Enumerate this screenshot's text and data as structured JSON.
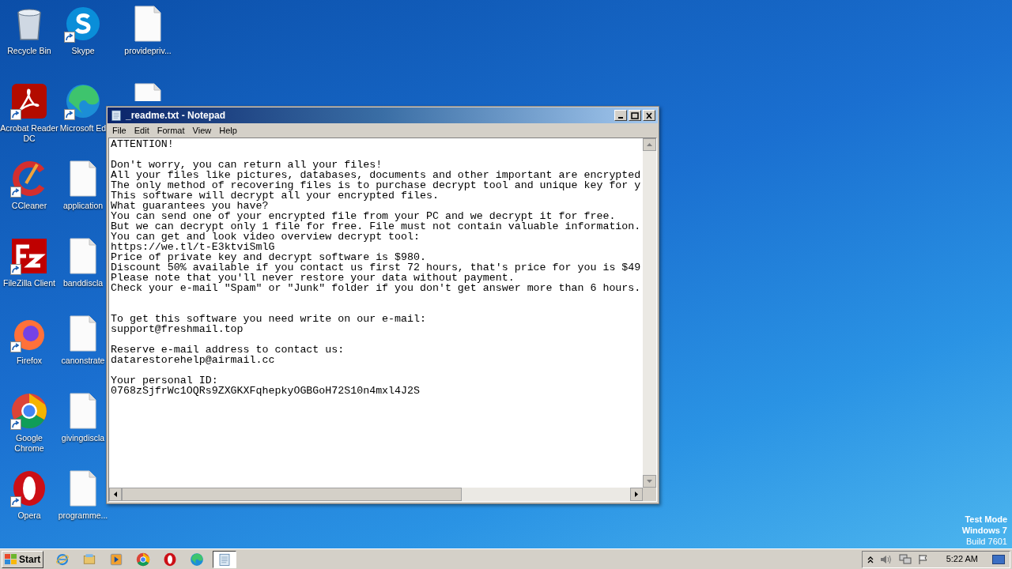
{
  "desktop_columns": [
    {
      "icons": [
        {
          "label": "Recycle Bin",
          "kind": "recycle",
          "shortcut": false
        },
        {
          "label": "Acrobat Reader DC",
          "kind": "acrobat",
          "shortcut": true
        },
        {
          "label": "CCleaner",
          "kind": "ccleaner",
          "shortcut": true
        },
        {
          "label": "FileZilla Client",
          "kind": "filezilla",
          "shortcut": true
        },
        {
          "label": "Firefox",
          "kind": "firefox",
          "shortcut": true
        },
        {
          "label": "Google Chrome",
          "kind": "chrome",
          "shortcut": true
        },
        {
          "label": "Opera",
          "kind": "opera",
          "shortcut": true
        }
      ]
    },
    {
      "icons": [
        {
          "label": "Skype",
          "kind": "skype",
          "shortcut": true
        },
        {
          "label": "Microsoft Ed",
          "kind": "edge",
          "shortcut": true
        },
        {
          "label": "application",
          "kind": "file",
          "shortcut": false
        },
        {
          "label": "banddiscla",
          "kind": "file",
          "shortcut": false
        },
        {
          "label": "canonstrate",
          "kind": "file",
          "shortcut": false
        },
        {
          "label": "givingdiscla",
          "kind": "file",
          "shortcut": false
        },
        {
          "label": "programme...",
          "kind": "file",
          "shortcut": false
        }
      ]
    },
    {
      "icons": [
        {
          "label": "providepriv...",
          "kind": "file",
          "shortcut": false
        },
        {
          "kind": "file",
          "shortcut": false
        }
      ]
    }
  ],
  "notepad": {
    "title": "_readme.txt - Notepad",
    "menu": [
      "File",
      "Edit",
      "Format",
      "View",
      "Help"
    ],
    "paragraphs": [
      {
        "kind": "first",
        "lines": [
          "ATTENTION!"
        ]
      },
      {
        "kind": "after_blank",
        "lines": [
          "Don't worry, you can return all your files!",
          "All your files like pictures, databases, documents and other important are encrypted",
          "The only method of recovering files is to purchase decrypt tool and unique key for y",
          "This software will decrypt all your encrypted files.",
          "What guarantees you have?",
          "You can send one of your encrypted file from your PC and we decrypt it for free.",
          "But we can decrypt only 1 file for free. File must not contain valuable information.",
          "You can get and look video overview decrypt tool:",
          "https://we.tl/t-E3ktviSmlG",
          "Price of private key and decrypt software is $980.",
          "Discount 50% available if you contact us first 72 hours, that's price for you is $49",
          "Please note that you'll never restore your data without payment.",
          "Check your e-mail \"Spam\" or \"Junk\" folder if you don't get answer more than 6 hours."
        ]
      },
      {
        "kind": "after_two_blanks",
        "lines": [
          "To get this software you need write on our e-mail:",
          "support@freshmail.top"
        ]
      },
      {
        "kind": "after_blank",
        "lines": [
          "Reserve e-mail address to contact us:",
          "datarestorehelp@airmail.cc"
        ]
      },
      {
        "kind": "after_blank",
        "lines": [
          "Your personal ID:",
          "0768zSjfrWc1OQRs9ZXGKXFqhepkyOGBGoH72S10n4mxl4J2S"
        ]
      }
    ]
  },
  "os_notice": [
    "Test Mode",
    "Windows 7",
    "Build 7601"
  ],
  "taskbar": {
    "start": "Start",
    "apps": [
      {
        "kind": "ie",
        "selected": false
      },
      {
        "kind": "explorer",
        "selected": false
      },
      {
        "kind": "media",
        "selected": false
      },
      {
        "kind": "chrome",
        "selected": false
      },
      {
        "kind": "opera",
        "selected": false
      },
      {
        "kind": "edge",
        "selected": false
      },
      {
        "kind": "notepad",
        "selected": true
      }
    ],
    "clock": "5:22 AM"
  }
}
